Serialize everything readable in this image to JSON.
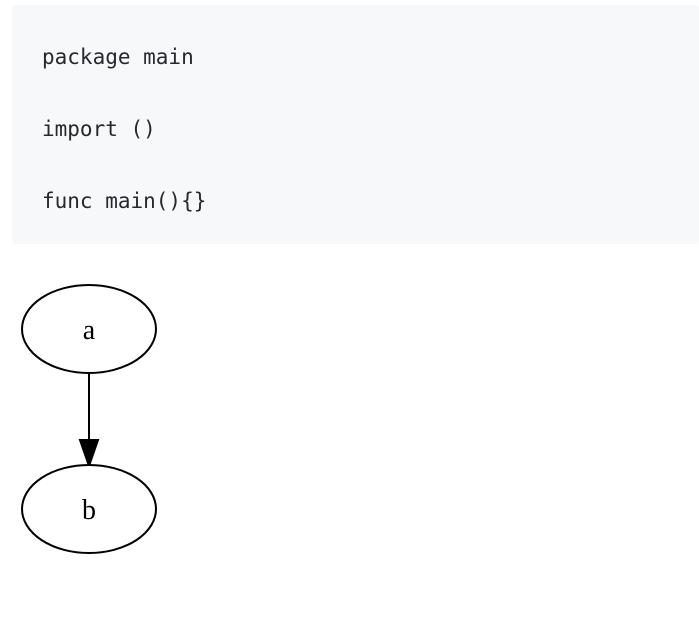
{
  "code_block": {
    "lines": [
      "package main",
      "",
      "import ()",
      "",
      "func main(){}"
    ]
  },
  "graph": {
    "nodes": [
      {
        "id": "a",
        "label": "a"
      },
      {
        "id": "b",
        "label": "b"
      }
    ],
    "edges": [
      {
        "from": "a",
        "to": "b"
      }
    ],
    "colors": {
      "stroke": "#000000",
      "fill": "#ffffff"
    }
  }
}
